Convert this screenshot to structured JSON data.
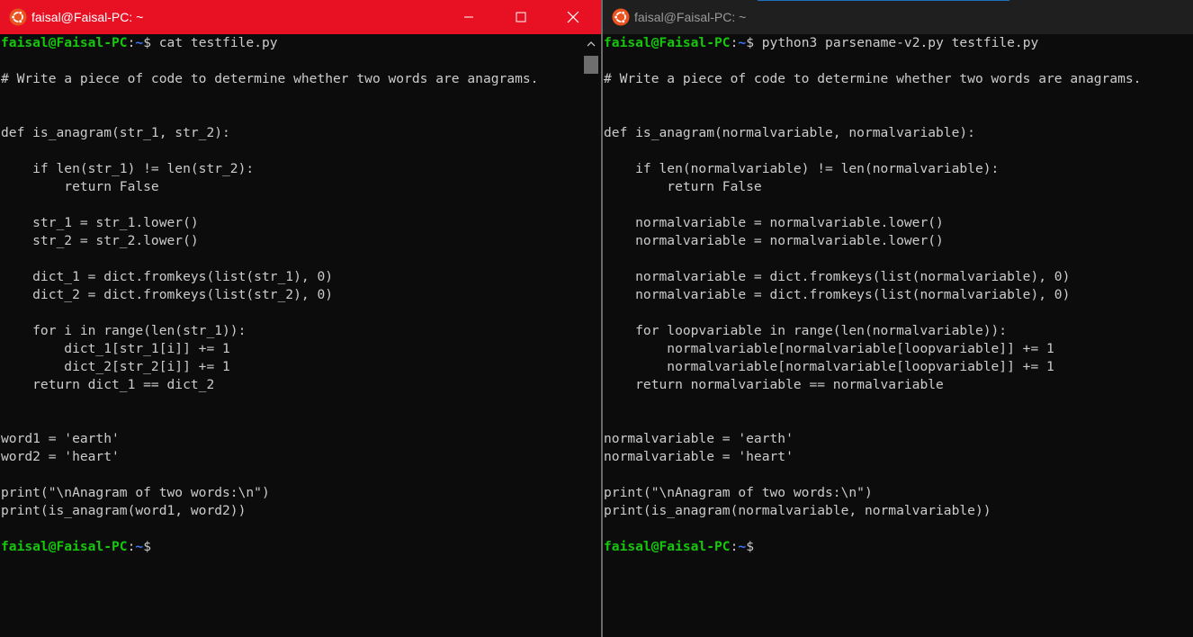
{
  "windows": [
    {
      "title": "faisal@Faisal-PC: ~",
      "active": true,
      "prompt": {
        "user": "faisal@Faisal-PC",
        "colon": ":",
        "path": "~",
        "sign": "$"
      },
      "lines": [
        {
          "type": "prompt",
          "cmd": " cat testfile.py"
        },
        {
          "type": "text",
          "text": ""
        },
        {
          "type": "text",
          "text": "# Write a piece of code to determine whether two words are anagrams."
        },
        {
          "type": "text",
          "text": ""
        },
        {
          "type": "text",
          "text": ""
        },
        {
          "type": "text",
          "text": "def is_anagram(str_1, str_2):"
        },
        {
          "type": "text",
          "text": ""
        },
        {
          "type": "text",
          "text": "    if len(str_1) != len(str_2):"
        },
        {
          "type": "text",
          "text": "        return False"
        },
        {
          "type": "text",
          "text": ""
        },
        {
          "type": "text",
          "text": "    str_1 = str_1.lower()"
        },
        {
          "type": "text",
          "text": "    str_2 = str_2.lower()"
        },
        {
          "type": "text",
          "text": ""
        },
        {
          "type": "text",
          "text": "    dict_1 = dict.fromkeys(list(str_1), 0)"
        },
        {
          "type": "text",
          "text": "    dict_2 = dict.fromkeys(list(str_2), 0)"
        },
        {
          "type": "text",
          "text": ""
        },
        {
          "type": "text",
          "text": "    for i in range(len(str_1)):"
        },
        {
          "type": "text",
          "text": "        dict_1[str_1[i]] += 1"
        },
        {
          "type": "text",
          "text": "        dict_2[str_2[i]] += 1"
        },
        {
          "type": "text",
          "text": "    return dict_1 == dict_2"
        },
        {
          "type": "text",
          "text": ""
        },
        {
          "type": "text",
          "text": ""
        },
        {
          "type": "text",
          "text": "word1 = 'earth'"
        },
        {
          "type": "text",
          "text": "word2 = 'heart'"
        },
        {
          "type": "text",
          "text": ""
        },
        {
          "type": "text",
          "text": "print(\"\\nAnagram of two words:\\n\")"
        },
        {
          "type": "text",
          "text": "print(is_anagram(word1, word2))"
        },
        {
          "type": "text",
          "text": ""
        },
        {
          "type": "prompt",
          "cmd": ""
        }
      ]
    },
    {
      "title": "faisal@Faisal-PC: ~",
      "active": false,
      "prompt": {
        "user": "faisal@Faisal-PC",
        "colon": ":",
        "path": "~",
        "sign": "$"
      },
      "lines": [
        {
          "type": "prompt",
          "cmd": " python3 parsename-v2.py testfile.py"
        },
        {
          "type": "text",
          "text": ""
        },
        {
          "type": "text",
          "text": "# Write a piece of code to determine whether two words are anagrams."
        },
        {
          "type": "text",
          "text": ""
        },
        {
          "type": "text",
          "text": ""
        },
        {
          "type": "text",
          "text": "def is_anagram(normalvariable, normalvariable):"
        },
        {
          "type": "text",
          "text": ""
        },
        {
          "type": "text",
          "text": "    if len(normalvariable) != len(normalvariable):"
        },
        {
          "type": "text",
          "text": "        return False"
        },
        {
          "type": "text",
          "text": ""
        },
        {
          "type": "text",
          "text": "    normalvariable = normalvariable.lower()"
        },
        {
          "type": "text",
          "text": "    normalvariable = normalvariable.lower()"
        },
        {
          "type": "text",
          "text": ""
        },
        {
          "type": "text",
          "text": "    normalvariable = dict.fromkeys(list(normalvariable), 0)"
        },
        {
          "type": "text",
          "text": "    normalvariable = dict.fromkeys(list(normalvariable), 0)"
        },
        {
          "type": "text",
          "text": ""
        },
        {
          "type": "text",
          "text": "    for loopvariable in range(len(normalvariable)):"
        },
        {
          "type": "text",
          "text": "        normalvariable[normalvariable[loopvariable]] += 1"
        },
        {
          "type": "text",
          "text": "        normalvariable[normalvariable[loopvariable]] += 1"
        },
        {
          "type": "text",
          "text": "    return normalvariable == normalvariable"
        },
        {
          "type": "text",
          "text": ""
        },
        {
          "type": "text",
          "text": ""
        },
        {
          "type": "text",
          "text": "normalvariable = 'earth'"
        },
        {
          "type": "text",
          "text": "normalvariable = 'heart'"
        },
        {
          "type": "text",
          "text": ""
        },
        {
          "type": "text",
          "text": "print(\"\\nAnagram of two words:\\n\")"
        },
        {
          "type": "text",
          "text": "print(is_anagram(normalvariable, normalvariable))"
        },
        {
          "type": "text",
          "text": ""
        },
        {
          "type": "prompt",
          "cmd": ""
        }
      ]
    }
  ],
  "colors": {
    "active_titlebar": "#e81123",
    "inactive_titlebar": "#1f1f1f",
    "terminal_bg": "#0c0c0c",
    "text": "#cccccc",
    "prompt_user": "#16c60c",
    "prompt_path": "#3b78ff"
  },
  "icons": {
    "app": "ubuntu-logo-icon",
    "minimize": "minimize-icon",
    "maximize": "maximize-icon",
    "close": "close-icon",
    "scroll_up": "scroll-up-arrow-icon"
  }
}
